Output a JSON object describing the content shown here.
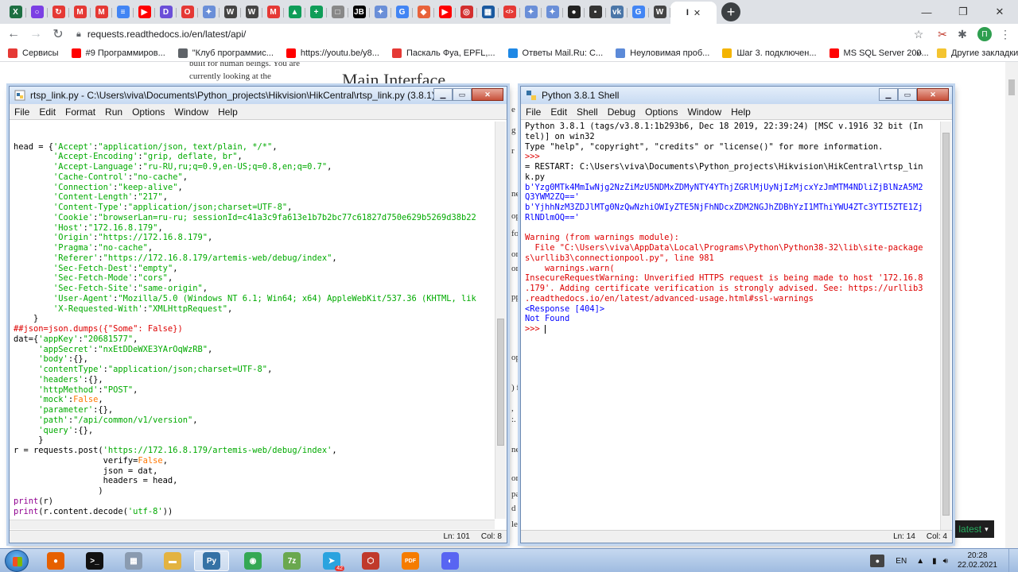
{
  "browser": {
    "url": "requests.readthedocs.io/en/latest/api/",
    "bookmarks": [
      {
        "label": "Сервисы",
        "icon": "apps-icon",
        "color": "#e53935"
      },
      {
        "label": "#9 Программиров...",
        "icon": "youtube-icon",
        "color": "#ff0000"
      },
      {
        "label": "\"Клуб программис...",
        "icon": "globe-icon",
        "color": "#5f6368"
      },
      {
        "label": "https://youtu.be/y8...",
        "icon": "youtube-icon",
        "color": "#ff0000"
      },
      {
        "label": "Паскаль Фуа, EPFL,...",
        "icon": "x-icon",
        "color": "#e53935"
      },
      {
        "label": "Ответы Mail.Ru: С...",
        "icon": "mail-icon",
        "color": "#1e88e5"
      },
      {
        "label": "Неуловимая проб...",
        "icon": "bookmark-page-icon",
        "color": "#5c8ad8"
      },
      {
        "label": "Шаг 3. подключен...",
        "icon": "windows-icon",
        "color": "#f4b400"
      },
      {
        "label": "MS SQL Server 200...",
        "icon": "youtube-icon",
        "color": "#ff0000"
      }
    ],
    "bookmarks_more": "»",
    "other_bookmarks": "Другие закладки",
    "tabs": [
      {
        "icon": "excel-icon",
        "glyph": "X",
        "color": "#1d6f42"
      },
      {
        "icon": "circle-icon",
        "glyph": "○",
        "color": "#7b3fe4"
      },
      {
        "icon": "redirect-icon",
        "glyph": "↻",
        "color": "#e53935"
      },
      {
        "icon": "m-icon",
        "glyph": "M",
        "color": "#e53935"
      },
      {
        "icon": "m-icon",
        "glyph": "M",
        "color": "#e53935"
      },
      {
        "icon": "docs-icon",
        "glyph": "≡",
        "color": "#4285f4"
      },
      {
        "icon": "youtube-icon",
        "glyph": "▶",
        "color": "#ff0000"
      },
      {
        "icon": "d-icon",
        "glyph": "D",
        "color": "#6b4fd8"
      },
      {
        "icon": "o-icon",
        "glyph": "O",
        "color": "#e53935"
      },
      {
        "icon": "puzzle-icon",
        "glyph": "✦",
        "color": "#6a8fd8"
      },
      {
        "icon": "wikipedia-icon",
        "glyph": "W",
        "color": "#444444"
      },
      {
        "icon": "wikipedia-icon",
        "glyph": "W",
        "color": "#444444"
      },
      {
        "icon": "m-icon",
        "glyph": "M",
        "color": "#e53935"
      },
      {
        "icon": "drive-icon",
        "glyph": "▲",
        "color": "#0f9d58"
      },
      {
        "icon": "sheets-icon",
        "glyph": "+",
        "color": "#0f9d58"
      },
      {
        "icon": "box-icon",
        "glyph": "□",
        "color": "#888888"
      },
      {
        "icon": "jb-icon",
        "glyph": "JB",
        "color": "#000000"
      },
      {
        "icon": "puzzle-icon",
        "glyph": "✦",
        "color": "#6a8fd8"
      },
      {
        "icon": "google-icon",
        "glyph": "G",
        "color": "#4285f4"
      },
      {
        "icon": "magento-icon",
        "glyph": "◆",
        "color": "#e8623a"
      },
      {
        "icon": "youtube-icon",
        "glyph": "▶",
        "color": "#ff0000"
      },
      {
        "icon": "target-icon",
        "glyph": "◎",
        "color": "#d32f2f"
      },
      {
        "icon": "chart-icon",
        "glyph": "▦",
        "color": "#1a5aa0"
      },
      {
        "icon": "code-icon",
        "glyph": "</>",
        "color": "#e53935"
      },
      {
        "icon": "puzzle-icon",
        "glyph": "✦",
        "color": "#6a8fd8"
      },
      {
        "icon": "puzzle-icon",
        "glyph": "✦",
        "color": "#6a8fd8"
      },
      {
        "icon": "github-icon",
        "glyph": "●",
        "color": "#222222"
      },
      {
        "icon": "gr-icon",
        "glyph": "▪",
        "color": "#333333"
      },
      {
        "icon": "vk-icon",
        "glyph": "vk",
        "color": "#4a76a8"
      },
      {
        "icon": "google-icon",
        "glyph": "G",
        "color": "#4285f4"
      },
      {
        "icon": "wikipedia-icon",
        "glyph": "W",
        "color": "#444444"
      }
    ],
    "active_tab_icon": "wikipedia-icon",
    "page": {
      "text_lines": [
        "built for human beings. You are",
        "currently looking at the"
      ],
      "heading": "Main Interface",
      "fragments": [
        "e",
        "g",
        "r",
        "ne",
        "op",
        "fo",
        "or",
        "or",
        "pp",
        "op",
        ") f",
        ",",
        ":.",
        "ne",
        "or",
        "pa",
        "d",
        "le"
      ],
      "version_badge": "latest",
      "version_caret": "▾"
    }
  },
  "editor": {
    "title": "rtsp_link.py - C:\\Users\\viva\\Documents\\Python_projects\\Hikvision\\HikCentral\\rtsp_link.py (3.8.1)",
    "menu": [
      "File",
      "Edit",
      "Format",
      "Run",
      "Options",
      "Window",
      "Help"
    ],
    "status_line": "Ln: 101",
    "status_col": "Col: 8",
    "code_lines": [
      [],
      [],
      [
        [
          "p",
          "head = {"
        ],
        [
          "s",
          "'Accept'"
        ],
        [
          "p",
          ":"
        ],
        [
          "s",
          "\"application/json, text/plain, */*\""
        ],
        [
          "p",
          ","
        ]
      ],
      [
        [
          "p",
          "        "
        ],
        [
          "s",
          "'Accept-Encoding'"
        ],
        [
          "p",
          ":"
        ],
        [
          "s",
          "\"grip, deflate, br\""
        ],
        [
          "p",
          ","
        ]
      ],
      [
        [
          "p",
          "        "
        ],
        [
          "s",
          "'Accept-Language'"
        ],
        [
          "p",
          ":"
        ],
        [
          "s",
          "\"ru-RU,ru;q=0.9,en-US;q=0.8,en;q=0.7\""
        ],
        [
          "p",
          ","
        ]
      ],
      [
        [
          "p",
          "        "
        ],
        [
          "s",
          "'Cache-Control'"
        ],
        [
          "p",
          ":"
        ],
        [
          "s",
          "\"no-cache\""
        ],
        [
          "p",
          ","
        ]
      ],
      [
        [
          "p",
          "        "
        ],
        [
          "s",
          "'Connection'"
        ],
        [
          "p",
          ":"
        ],
        [
          "s",
          "\"keep-alive\""
        ],
        [
          "p",
          ","
        ]
      ],
      [
        [
          "p",
          "        "
        ],
        [
          "s",
          "'Content-Length'"
        ],
        [
          "p",
          ":"
        ],
        [
          "s",
          "\"217\""
        ],
        [
          "p",
          ","
        ]
      ],
      [
        [
          "p",
          "        "
        ],
        [
          "s",
          "'Content-Type'"
        ],
        [
          "p",
          ":"
        ],
        [
          "s",
          "\"application/json;charset=UTF-8\""
        ],
        [
          "p",
          ","
        ]
      ],
      [
        [
          "p",
          "        "
        ],
        [
          "s",
          "'Cookie'"
        ],
        [
          "p",
          ":"
        ],
        [
          "s",
          "\"browserLan=ru-ru; sessionId=c41a3c9fa613e1b7b2bc77c61827d750e629b5269d38b22"
        ]
      ],
      [
        [
          "p",
          "        "
        ],
        [
          "s",
          "'Host'"
        ],
        [
          "p",
          ":"
        ],
        [
          "s",
          "\"172.16.8.179\""
        ],
        [
          "p",
          ","
        ]
      ],
      [
        [
          "p",
          "        "
        ],
        [
          "s",
          "'Origin'"
        ],
        [
          "p",
          ":"
        ],
        [
          "s",
          "\"https://172.16.8.179\""
        ],
        [
          "p",
          ","
        ]
      ],
      [
        [
          "p",
          "        "
        ],
        [
          "s",
          "'Pragma'"
        ],
        [
          "p",
          ":"
        ],
        [
          "s",
          "\"no-cache\""
        ],
        [
          "p",
          ","
        ]
      ],
      [
        [
          "p",
          "        "
        ],
        [
          "s",
          "'Referer'"
        ],
        [
          "p",
          ":"
        ],
        [
          "s",
          "\"https://172.16.8.179/artemis-web/debug/index\""
        ],
        [
          "p",
          ","
        ]
      ],
      [
        [
          "p",
          "        "
        ],
        [
          "s",
          "'Sec-Fetch-Dest'"
        ],
        [
          "p",
          ":"
        ],
        [
          "s",
          "\"empty\""
        ],
        [
          "p",
          ","
        ]
      ],
      [
        [
          "p",
          "        "
        ],
        [
          "s",
          "'Sec-Fetch-Mode'"
        ],
        [
          "p",
          ":"
        ],
        [
          "s",
          "\"cors\""
        ],
        [
          "p",
          ","
        ]
      ],
      [
        [
          "p",
          "        "
        ],
        [
          "s",
          "'Sec-Fetch-Site'"
        ],
        [
          "p",
          ":"
        ],
        [
          "s",
          "\"same-origin\""
        ],
        [
          "p",
          ","
        ]
      ],
      [
        [
          "p",
          "        "
        ],
        [
          "s",
          "'User-Agent'"
        ],
        [
          "p",
          ":"
        ],
        [
          "s",
          "\"Mozilla/5.0 (Windows NT 6.1; Win64; x64) AppleWebKit/537.36 (KHTML, lik"
        ]
      ],
      [
        [
          "p",
          "        "
        ],
        [
          "s",
          "'X-Requested-With'"
        ],
        [
          "p",
          ":"
        ],
        [
          "s",
          "\"XMLHttpRequest\""
        ],
        [
          "p",
          ","
        ]
      ],
      [
        [
          "p",
          "    }"
        ]
      ],
      [
        [
          "c",
          "##json=json.dumps({\"Some\": False})"
        ]
      ],
      [
        [
          "p",
          "dat={"
        ],
        [
          "s",
          "'appKey'"
        ],
        [
          "p",
          ":"
        ],
        [
          "s",
          "\"20681577\""
        ],
        [
          "p",
          ","
        ]
      ],
      [
        [
          "p",
          "     "
        ],
        [
          "s",
          "'appSecret'"
        ],
        [
          "p",
          ":"
        ],
        [
          "s",
          "\"nxEtDDeWXE3YArOqWzRB\""
        ],
        [
          "p",
          ","
        ]
      ],
      [
        [
          "p",
          "     "
        ],
        [
          "s",
          "'body'"
        ],
        [
          "p",
          ":{},"
        ]
      ],
      [
        [
          "p",
          "     "
        ],
        [
          "s",
          "'contentType'"
        ],
        [
          "p",
          ":"
        ],
        [
          "s",
          "\"application/json;charset=UTF-8\""
        ],
        [
          "p",
          ","
        ]
      ],
      [
        [
          "p",
          "     "
        ],
        [
          "s",
          "'headers'"
        ],
        [
          "p",
          ":{},"
        ]
      ],
      [
        [
          "p",
          "     "
        ],
        [
          "s",
          "'httpMethod'"
        ],
        [
          "p",
          ":"
        ],
        [
          "s",
          "\"POST\""
        ],
        [
          "p",
          ","
        ]
      ],
      [
        [
          "p",
          "     "
        ],
        [
          "s",
          "'mock'"
        ],
        [
          "p",
          ":"
        ],
        [
          "k",
          "False"
        ],
        [
          "p",
          ","
        ]
      ],
      [
        [
          "p",
          "     "
        ],
        [
          "s",
          "'parameter'"
        ],
        [
          "p",
          ":{},"
        ]
      ],
      [
        [
          "p",
          "     "
        ],
        [
          "s",
          "'path'"
        ],
        [
          "p",
          ":"
        ],
        [
          "s",
          "\"/api/common/v1/version\""
        ],
        [
          "p",
          ","
        ]
      ],
      [
        [
          "p",
          "     "
        ],
        [
          "s",
          "'query'"
        ],
        [
          "p",
          ":{},"
        ]
      ],
      [
        [
          "p",
          "     }"
        ]
      ],
      [
        [
          "p",
          "r = requests.post("
        ],
        [
          "s",
          "'https://172.16.8.179/artemis-web/debug/index'"
        ],
        [
          "p",
          ","
        ]
      ],
      [
        [
          "p",
          "                  verify="
        ],
        [
          "k",
          "False"
        ],
        [
          "p",
          ","
        ]
      ],
      [
        [
          "p",
          "                  json = dat,"
        ]
      ],
      [
        [
          "p",
          "                  headers = head,"
        ]
      ],
      [
        [
          "p",
          "                 )"
        ]
      ],
      [
        [
          "b",
          "print"
        ],
        [
          "p",
          "(r)"
        ]
      ],
      [
        [
          "b",
          "print"
        ],
        [
          "p",
          "(r.content.decode("
        ],
        [
          "s",
          "'utf-8'"
        ],
        [
          "p",
          "))"
        ]
      ]
    ]
  },
  "shell": {
    "title": "Python 3.8.1 Shell",
    "menu": [
      "File",
      "Edit",
      "Shell",
      "Debug",
      "Options",
      "Window",
      "Help"
    ],
    "status_line": "Ln: 14",
    "status_col": "Col: 4",
    "lines": [
      [
        [
          "p",
          "Python 3.8.1 (tags/v3.8.1:1b293b6, Dec 18 2019, 22:39:24) [MSC v.1916 32 bit (In"
        ]
      ],
      [
        [
          "p",
          "tel)] on win32"
        ]
      ],
      [
        [
          "p",
          "Type \"help\", \"copyright\", \"credits\" or \"license()\" for more information."
        ]
      ],
      [
        [
          "c",
          ">>> "
        ]
      ],
      [
        [
          "p",
          "= RESTART: C:\\Users\\viva\\Documents\\Python_projects\\Hikvision\\HikCentral\\rtsp_lin"
        ]
      ],
      [
        [
          "p",
          "k.py"
        ]
      ],
      [
        [
          "o",
          "b'Yzg0MTk4MmIwNjg2NzZiMzU5NDMxZDMyNTY4YThjZGRlMjUyNjIzMjcxYzJmMTM4NDliZjBlNzA5M2"
        ]
      ],
      [
        [
          "o",
          "Q3YWM2ZQ=='"
        ]
      ],
      [
        [
          "o",
          "b'YjhhNzM3ZDJlMTg0NzQwNzhiOWIyZTE5NjFhNDcxZDM2NGJhZDBhYzI1MThiYWU4ZTc3YTI5ZTE1Zj"
        ]
      ],
      [
        [
          "o",
          "RlNDlmOQ=='"
        ]
      ],
      [],
      [
        [
          "e",
          "Warning (from warnings module):"
        ]
      ],
      [
        [
          "e",
          "  File \"C:\\Users\\viva\\AppData\\Local\\Programs\\Python\\Python38-32\\lib\\site-package"
        ]
      ],
      [
        [
          "e",
          "s\\urllib3\\connectionpool.py\", line 981"
        ]
      ],
      [
        [
          "e",
          "    warnings.warn("
        ]
      ],
      [
        [
          "e",
          "InsecureRequestWarning: Unverified HTTPS request is being made to host '172.16.8"
        ]
      ],
      [
        [
          "e",
          ".179'. Adding certificate verification is strongly advised. See: https://urllib3"
        ]
      ],
      [
        [
          "e",
          ".readthedocs.io/en/latest/advanced-usage.html#ssl-warnings"
        ]
      ],
      [
        [
          "o",
          "<Response [404]>"
        ]
      ],
      [
        [
          "o",
          "Not Found"
        ]
      ],
      [
        [
          "c",
          ">>> "
        ]
      ]
    ]
  },
  "taskbar": {
    "language": "EN",
    "time": "20:28",
    "date": "22.02.2021",
    "telegram_badge": "42",
    "apps": [
      {
        "icon": "firefox-icon",
        "glyph": "●",
        "color": "#e66000"
      },
      {
        "icon": "cmd-icon",
        "glyph": ">_",
        "color": "#111111"
      },
      {
        "icon": "calculator-icon",
        "glyph": "▦",
        "color": "#8a9bb0"
      },
      {
        "icon": "folder-icon",
        "glyph": "▬",
        "color": "#e3b341"
      },
      {
        "icon": "python-icon",
        "glyph": "Py",
        "color": "#3572a5"
      },
      {
        "icon": "chrome-icon",
        "glyph": "◉",
        "color": "#34a853"
      },
      {
        "icon": "7zip-icon",
        "glyph": "7z",
        "color": "#6aa84f"
      },
      {
        "icon": "telegram-icon",
        "glyph": "➤",
        "color": "#2aa3df"
      },
      {
        "icon": "box3d-icon",
        "glyph": "⬡",
        "color": "#c0392b"
      },
      {
        "icon": "pdf-icon",
        "glyph": "PDF",
        "color": "#f57c00"
      },
      {
        "icon": "discord-icon",
        "glyph": "◐",
        "color": "#5865f2"
      }
    ]
  }
}
